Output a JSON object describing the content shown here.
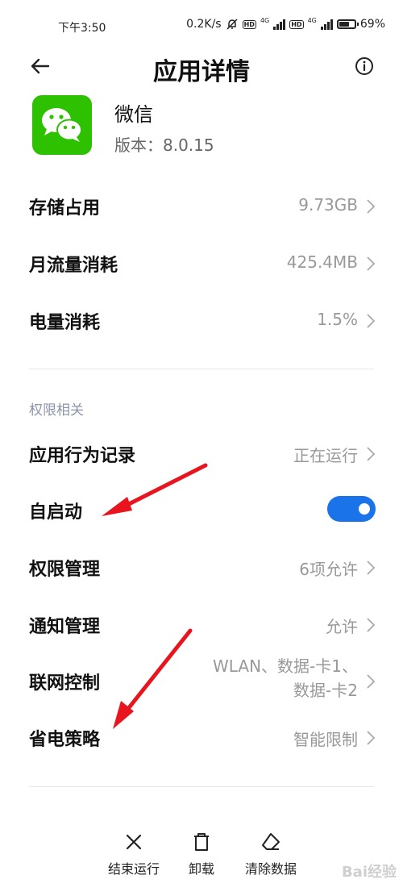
{
  "status_bar": {
    "time": "下午3:50",
    "speed": "0.2K/s",
    "net1": "4G",
    "net2": "4G",
    "hd": "HD",
    "battery_level": 0.69,
    "battery_text": "69%"
  },
  "header": {
    "title": "应用详情",
    "back_icon": "back-arrow-icon",
    "info_icon": "info-icon"
  },
  "app": {
    "name": "微信",
    "version": "版本：8.0.15",
    "icon": "wechat-icon",
    "brand_color": "#2dc100"
  },
  "usage": [
    {
      "label": "存储占用",
      "value": "9.73GB"
    },
    {
      "label": "月流量消耗",
      "value": "425.4MB"
    },
    {
      "label": "电量消耗",
      "value": "1.5%"
    }
  ],
  "permissions": {
    "section_title": "权限相关",
    "items": [
      {
        "label": "应用行为记录",
        "value": "正在运行"
      },
      {
        "label": "自启动",
        "toggle_on": true,
        "toggle_color": "#1a73e8"
      },
      {
        "label": "权限管理",
        "value": "6项允许"
      },
      {
        "label": "通知管理",
        "value": "允许"
      },
      {
        "label": "联网控制",
        "value_line1": "WLAN、数据-卡1、",
        "value_line2": "数据-卡2"
      },
      {
        "label": "省电策略",
        "value": "智能限制"
      }
    ]
  },
  "bottom_actions": [
    {
      "label": "结束运行",
      "icon": "close-icon"
    },
    {
      "label": "卸载",
      "icon": "trash-icon"
    },
    {
      "label": "清除数据",
      "icon": "eraser-icon"
    }
  ],
  "annotation_color": "#e8141e",
  "watermark": "Bai经验"
}
